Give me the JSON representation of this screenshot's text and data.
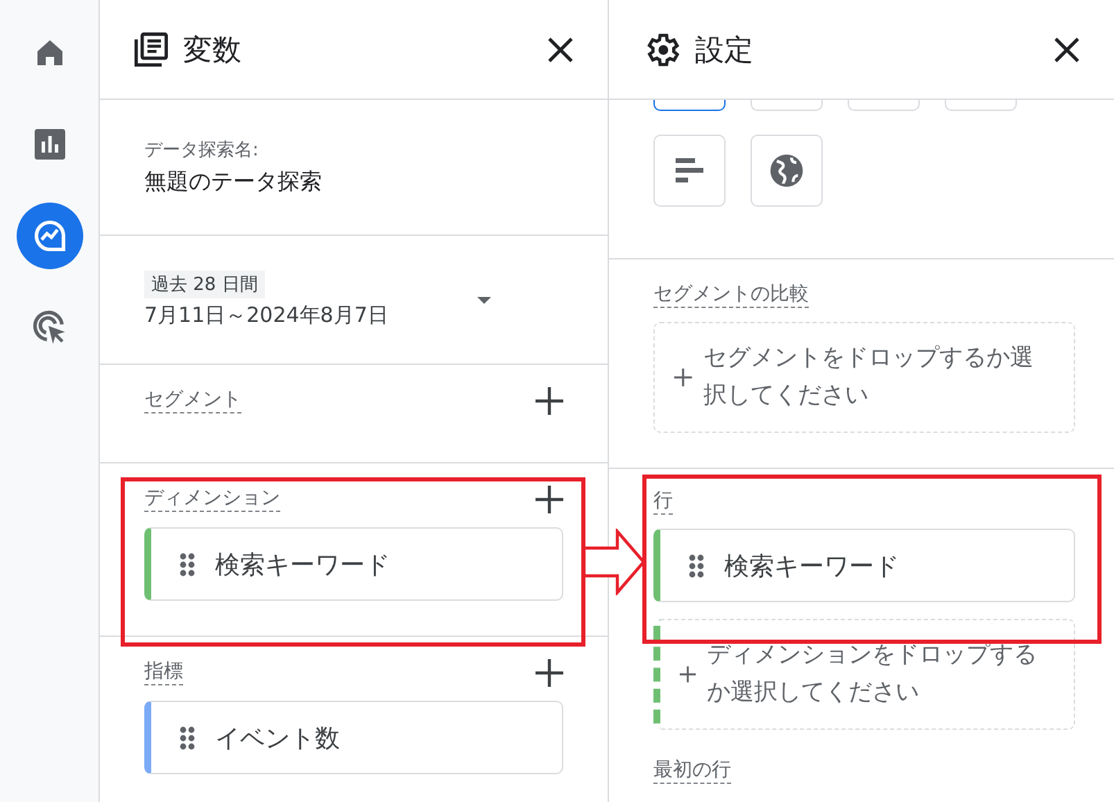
{
  "nav": [
    {
      "selected": false
    },
    {
      "selected": false
    },
    {
      "selected": true
    },
    {
      "selected": false
    }
  ],
  "variables": {
    "title": "変数",
    "name_label": "データ探索名:",
    "name_value": "無題のテータ探索",
    "date_chip": "過去 28 日間",
    "date_range": "7月11日～2024年8月7日",
    "segments": {
      "label": "セグメント"
    },
    "dimensions": {
      "label": "ディメンション",
      "items": [
        {
          "text": "検索キーワード",
          "color": "#6fbf73"
        }
      ]
    },
    "metrics": {
      "label": "指標",
      "items": [
        {
          "text": "イベント数",
          "color": "#7baaf7"
        }
      ]
    }
  },
  "settings": {
    "title": "設定",
    "chips_top": [
      {
        "selected": true
      },
      {
        "selected": false
      },
      {
        "selected": false
      },
      {
        "selected": false
      }
    ],
    "chips": [
      {
        "kind": "bar",
        "selected": false
      },
      {
        "kind": "globe",
        "selected": false
      }
    ],
    "segment_compare": {
      "label": "セグメントの比較",
      "drop": "セグメントをドロップするか選択してください"
    },
    "rows": {
      "label": "行",
      "items": [
        {
          "text": "検索キーワード",
          "color": "#6fbf73"
        }
      ],
      "drop": "ディメンションをドロップするか選択してください"
    },
    "first_row": {
      "label": "最初の行"
    }
  }
}
